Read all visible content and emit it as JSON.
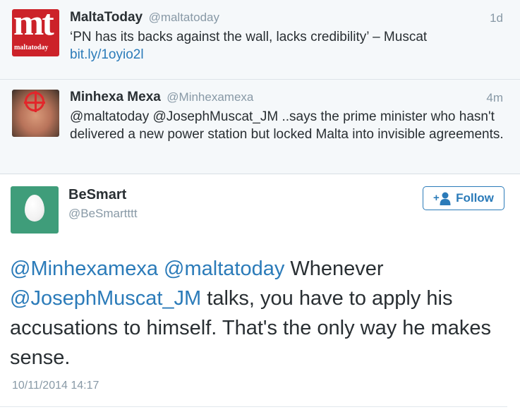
{
  "thread": [
    {
      "name": "MaltaToday",
      "handle": "@maltatoday",
      "time": "1d",
      "avatar_text_big": "mt",
      "avatar_text_small": "maltatoday",
      "text": "‘PN has its backs against the wall, lacks credibility’ – Muscat",
      "link": "bit.ly/1oyio2l"
    },
    {
      "name": "Minhexa Mexa",
      "handle": "@Minhexamexa",
      "time": "4m",
      "text": "@maltatoday @JosephMuscat_JM ..says the prime minister who hasn't delivered a new power station but locked Malta into invisible agreements."
    }
  ],
  "main_tweet": {
    "name": "BeSmart",
    "handle": "@BeSmartttt",
    "follow_label": "Follow",
    "mention1": "@Minhexamexa",
    "mention2": "@maltatoday",
    "text_part1": " Whenever ",
    "mention3": "@JosephMuscat_JM",
    "text_part2": " talks, you have to apply his accusations to himself. That's the only way he makes sense.",
    "timestamp": "10/11/2014 14:17"
  },
  "colors": {
    "link": "#2b7bb9",
    "meta": "#8899a6",
    "maltatoday_red": "#cc2229",
    "egg_green": "#3f9d7a"
  },
  "icons": {
    "follow": "add-user-icon",
    "egg": "default-egg-avatar"
  }
}
